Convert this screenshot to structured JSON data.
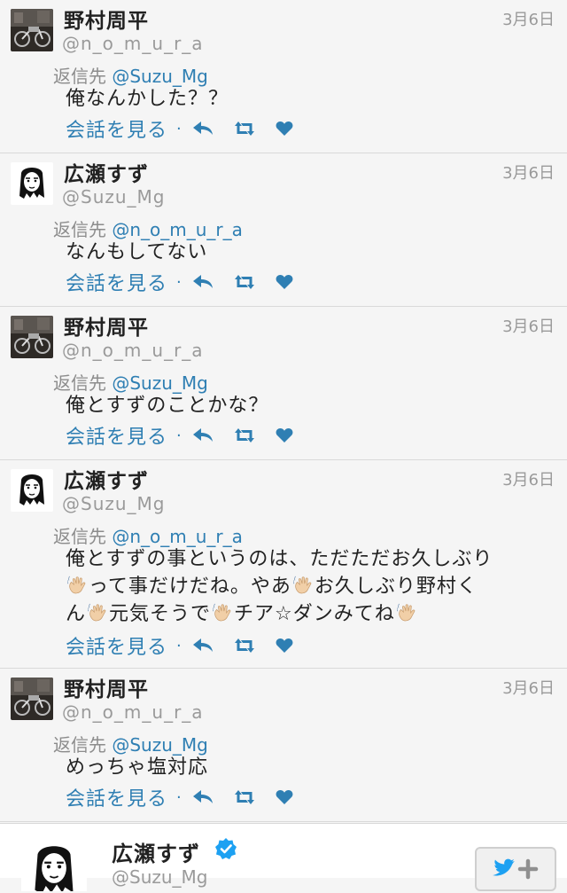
{
  "tweets": [
    {
      "name": "野村周平",
      "handle": "@n_o_m_u_r_a",
      "date": "3月6日",
      "reply_label": "返信先",
      "reply_mention": "@Suzu_Mg",
      "avatar": "motorcycle-photo",
      "lines": [
        "俺なんかした？？"
      ],
      "conversation_label": "会話を見る"
    },
    {
      "name": "広瀬すず",
      "handle": "@Suzu_Mg",
      "date": "3月6日",
      "reply_label": "返信先",
      "reply_mention": "@n_o_m_u_r_a",
      "avatar": "drawn-face",
      "lines": [
        "なんもしてない"
      ],
      "conversation_label": "会話を見る"
    },
    {
      "name": "野村周平",
      "handle": "@n_o_m_u_r_a",
      "date": "3月6日",
      "reply_label": "返信先",
      "reply_mention": "@Suzu_Mg",
      "avatar": "motorcycle-photo",
      "lines": [
        "俺とすずのことかな？"
      ],
      "conversation_label": "会話を見る"
    },
    {
      "name": "広瀬すず",
      "handle": "@Suzu_Mg",
      "date": "3月6日",
      "reply_label": "返信先",
      "reply_mention": "@n_o_m_u_r_a",
      "avatar": "drawn-face",
      "lines": [
        "俺とすずの事というのは、ただただお久しぶり",
        "って事だけだね。やあ",
        "お久しぶり野村く",
        "ん",
        "元気そうで",
        "チア☆ダンみてね"
      ],
      "conversation_label": "会話を見る"
    },
    {
      "name": "野村周平",
      "handle": "@n_o_m_u_r_a",
      "date": "3月6日",
      "reply_label": "返信先",
      "reply_mention": "@Suzu_Mg",
      "avatar": "motorcycle-photo",
      "lines": [
        "めっちゃ塩対応"
      ],
      "conversation_label": "会話を見る"
    }
  ],
  "actions": {
    "separator": "·",
    "icons": [
      "reply-icon",
      "retweet-icon",
      "like-icon"
    ]
  },
  "colors": {
    "link": "#2f7fb3",
    "muted": "#9a9a9a",
    "background": "#f5f5f5",
    "twitter_blue": "#1da1f2"
  },
  "profile_card": {
    "name": "広瀬すず",
    "handle": "@Suzu_Mg",
    "verified": true,
    "follow_icon": "twitter-bird-plus-icon"
  }
}
